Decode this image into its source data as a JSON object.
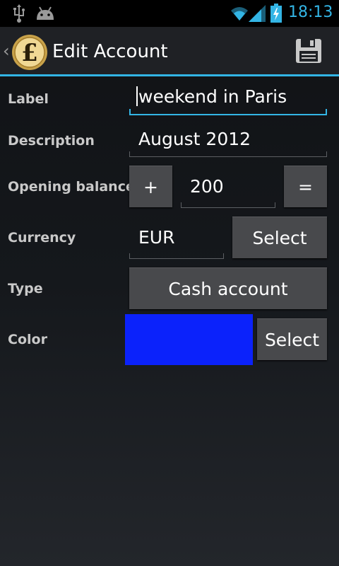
{
  "status_bar": {
    "time": "18:13"
  },
  "action_bar": {
    "title": "Edit Account"
  },
  "form": {
    "label": {
      "caption": "Label",
      "value": "weekend in Paris"
    },
    "description": {
      "caption": "Description",
      "value": "August 2012"
    },
    "opening_balance": {
      "caption": "Opening balance",
      "sign": "+",
      "value": "200",
      "equals": "="
    },
    "currency": {
      "caption": "Currency",
      "value": "EUR",
      "select_label": "Select"
    },
    "type": {
      "caption": "Type",
      "value": "Cash account"
    },
    "color": {
      "caption": "Color",
      "value": "#0b22fb",
      "select_label": "Select"
    }
  },
  "colors": {
    "accent": "#33b5e5",
    "background": "#15181c",
    "button": "#48494c"
  },
  "icons": [
    "usb-icon",
    "android-icon",
    "wifi-icon",
    "signal-icon",
    "battery-charging-icon",
    "back-chevron-icon",
    "pound-coin-logo",
    "save-icon"
  ]
}
